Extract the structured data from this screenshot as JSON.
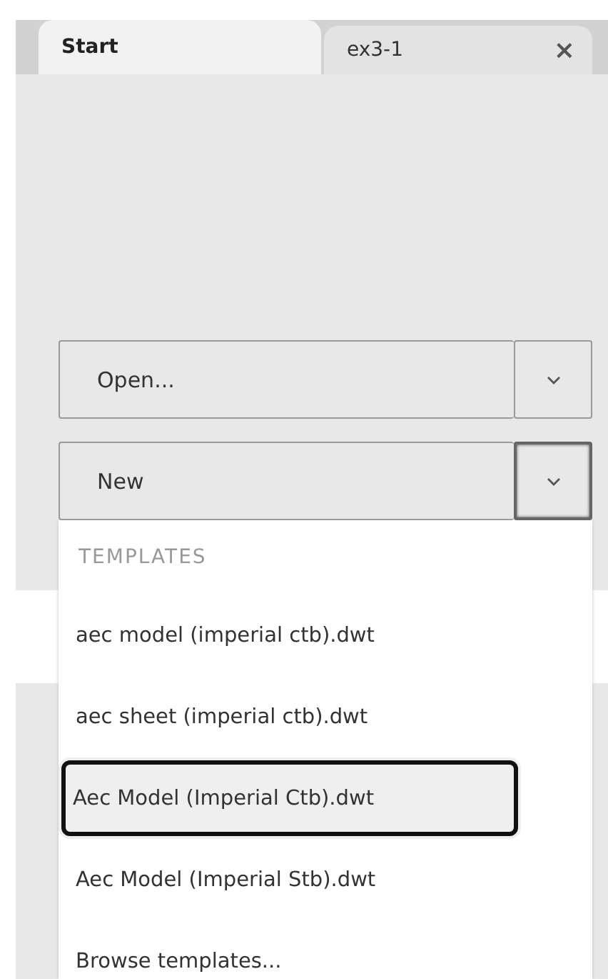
{
  "tabs": [
    {
      "label": "Start",
      "selected": true
    },
    {
      "label": "ex3-1",
      "selected": false,
      "close": "×"
    }
  ],
  "actions": [
    {
      "label": "Open...",
      "open": false
    },
    {
      "label": "New",
      "open": true
    }
  ],
  "menu": {
    "header": "TEMPLATES",
    "items": [
      {
        "label": "aec model (imperial ctb).dwt",
        "selected": false
      },
      {
        "label": "aec sheet (imperial ctb).dwt",
        "selected": false
      },
      {
        "label": "Aec Model (Imperial Ctb).dwt",
        "selected": true
      },
      {
        "label": "Aec Model (Imperial Stb).dwt",
        "selected": false
      },
      {
        "label": "Browse templates...",
        "selected": false
      }
    ]
  }
}
